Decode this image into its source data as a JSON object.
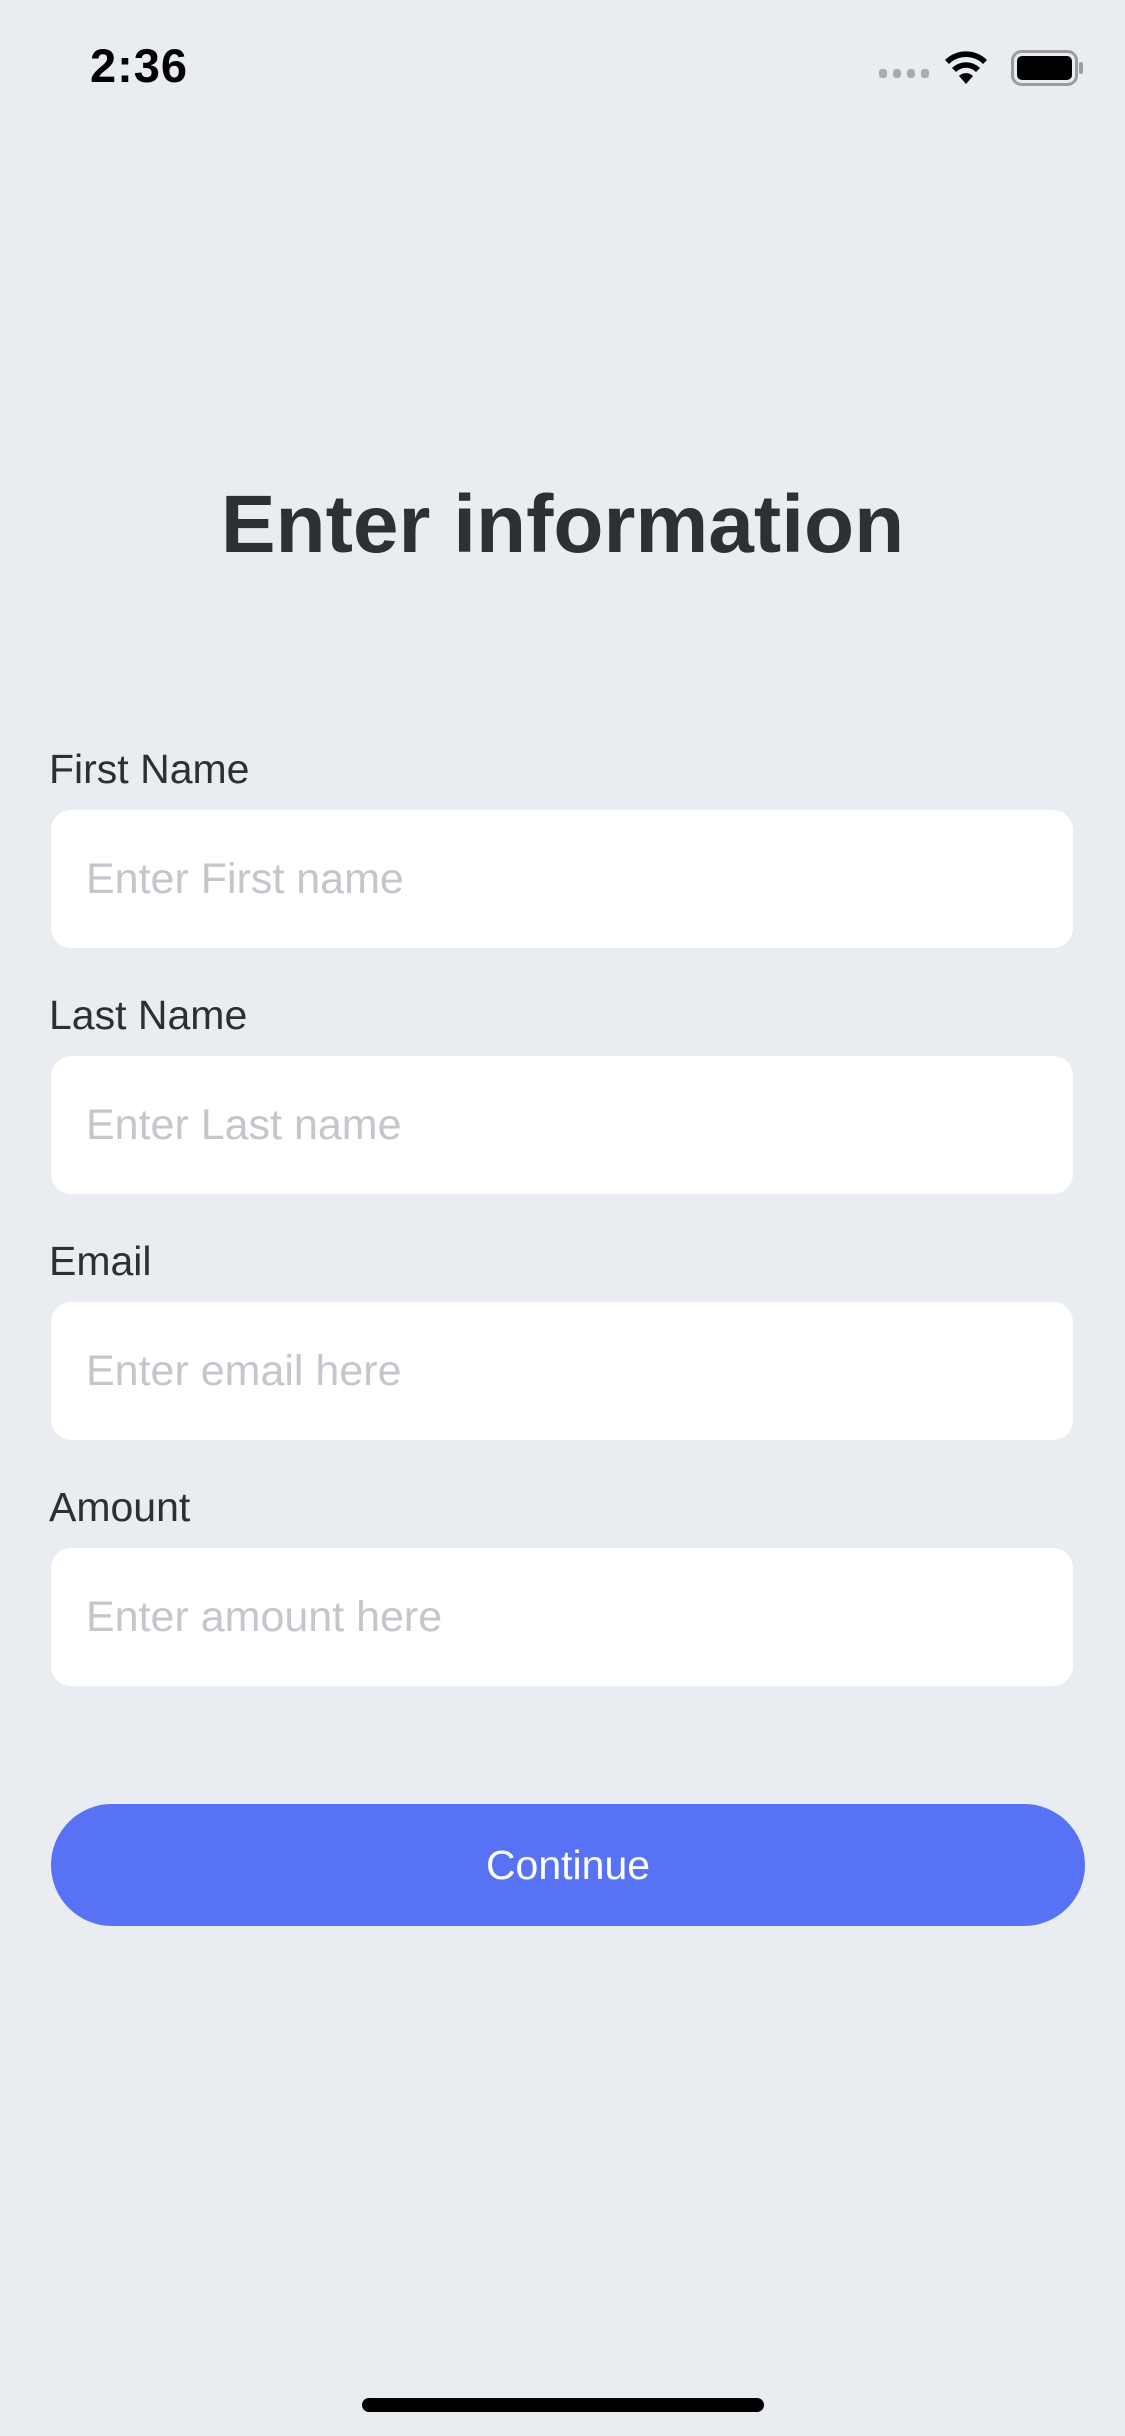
{
  "status_bar": {
    "time": "2:36",
    "icons": [
      "cellular-signal-icon",
      "wifi-icon",
      "battery-icon"
    ]
  },
  "page": {
    "title": "Enter information"
  },
  "form": {
    "fields": [
      {
        "label": "First Name",
        "placeholder": "Enter First name",
        "value": ""
      },
      {
        "label": "Last Name",
        "placeholder": "Enter Last name",
        "value": ""
      },
      {
        "label": "Email",
        "placeholder": "Enter email here",
        "value": ""
      },
      {
        "label": "Amount",
        "placeholder": "Enter amount here",
        "value": ""
      }
    ],
    "continue_label": "Continue"
  },
  "colors": {
    "background": "#e9ecf1",
    "field_background": "#ffffff",
    "primary_button": "#5872f6",
    "placeholder_text": "#c4c6cb",
    "label_text": "#2e2f33"
  }
}
